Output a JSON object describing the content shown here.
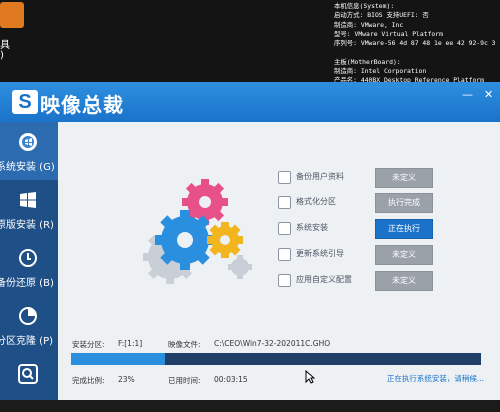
{
  "desktop": {
    "icon_label_1": "具",
    "icon_label_2": ")",
    "sysinfo": [
      "本机信息(System):",
      "启动方式: BIOS      支持UEFI: 否",
      "制造商: VMware, Inc",
      "型号: VMware Virtual Platform",
      "序列号: VMware-56 4d 87 48 1e ee 42 92-9c 3",
      "",
      "主板(MotherBoard):",
      "制造商: Intel Corporation",
      "产品名: 440BX Desktop Reference Platform"
    ]
  },
  "app": {
    "logo_letter": "S",
    "title": "映像总裁",
    "minimize": "—",
    "close": "✕"
  },
  "sidebar": {
    "items": [
      {
        "label": "系统安装 (G)",
        "icon": "disc-icon",
        "active": true
      },
      {
        "label": "原版安装 (R)",
        "icon": "windows-icon",
        "active": false
      },
      {
        "label": "备份还原 (B)",
        "icon": "backup-icon",
        "active": false
      },
      {
        "label": "分区克隆 (P)",
        "icon": "pie-icon",
        "active": false
      },
      {
        "label": "",
        "icon": "search-icon",
        "active": false
      }
    ]
  },
  "steps": [
    {
      "label": "备份用户资料",
      "status": "未定义",
      "icon": "document-icon"
    },
    {
      "label": "格式化分区",
      "status": "执行完成",
      "icon": "grid-icon"
    },
    {
      "label": "系统安装",
      "status": "正在执行",
      "icon": "windows-icon"
    },
    {
      "label": "更新系统引导",
      "status": "未定义",
      "icon": "refresh-icon"
    },
    {
      "label": "应用自定义配置",
      "status": "未定义",
      "icon": "gear-icon"
    }
  ],
  "install": {
    "partition_label": "安装分区:",
    "partition_value": "F:[1:1]",
    "image_label": "映像文件:",
    "image_value": "C:\\CEO\\Win7-32-202011C.GHO",
    "ratio_label": "完成比例:",
    "ratio_value": "23%",
    "progress_fraction": 0.23,
    "elapsed_label": "已用时间:",
    "elapsed_value": "00:03:15",
    "status_text": "正在执行系统安装，请稍候..."
  },
  "colors": {
    "accent": "#1a73c9",
    "sidebar": "#1e4f86",
    "progress_track": "#1f3f66",
    "progress_fill": "#2b8fe0",
    "button_idle": "#9aa1a9"
  }
}
